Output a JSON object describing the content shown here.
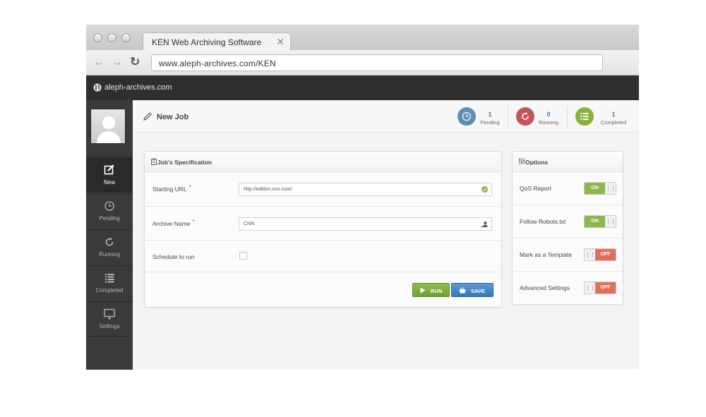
{
  "browser": {
    "tab_title": "KEN Web Archiving Software",
    "tab_close": "✕",
    "back": "←",
    "forward": "→",
    "reload": "↻",
    "address": "www.aleph-archives.com/KEN"
  },
  "site": {
    "name": "aleph-archives.com"
  },
  "sidebar": {
    "items": [
      {
        "label": "New",
        "icon": "edit-icon"
      },
      {
        "label": "Pending",
        "icon": "clock-icon"
      },
      {
        "label": "Running",
        "icon": "refresh-icon"
      },
      {
        "label": "Completed",
        "icon": "list-icon"
      },
      {
        "label": "Settings",
        "icon": "monitor-icon"
      }
    ]
  },
  "header": {
    "title": "New Job",
    "stats": [
      {
        "value": "1",
        "label": "Pending",
        "color": "#5b8fb5"
      },
      {
        "value": "0",
        "label": "Running",
        "color": "#c0575a"
      },
      {
        "value": "1",
        "label": "Completed",
        "color": "#86b23f"
      }
    ]
  },
  "job_spec": {
    "title": "Job's Specification",
    "starting_url_label": "Starting URL",
    "starting_url_value": "http://edition.cnn.com/",
    "archive_name_label": "Archive Name",
    "archive_name_value": "CNN",
    "schedule_label": "Schedule to run",
    "required_mark": "*",
    "run_label": "RUN",
    "save_label": "SAVE"
  },
  "options": {
    "title": "Options",
    "items": [
      {
        "label": "QoS Report",
        "state": "ON"
      },
      {
        "label": "Follow Robots.txt",
        "state": "ON"
      },
      {
        "label": "Mark as a Template",
        "state": "OFF"
      },
      {
        "label": "Advanced Settings",
        "state": "OFF"
      }
    ]
  },
  "colors": {
    "green": "#86b23f",
    "blue": "#3d7fc1",
    "red": "#e0705a"
  }
}
